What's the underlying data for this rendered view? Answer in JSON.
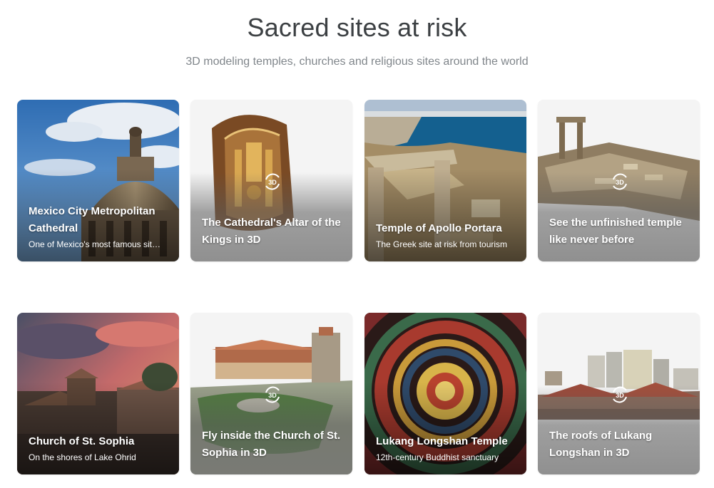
{
  "header": {
    "title": "Sacred sites at risk",
    "subtitle": "3D modeling temples, churches and religious sites around the world"
  },
  "badge_label": "3D",
  "cards": [
    {
      "title": "Mexico City Metropolitan Cathedral",
      "subtitle": "One of Mexico's most famous sit…"
    },
    {
      "title": "The Cathedral's Altar of the Kings in 3D",
      "is_3d": true
    },
    {
      "title": "Temple of Apollo Portara",
      "subtitle": "The Greek site at risk from tourism"
    },
    {
      "title": "See the unfinished temple like never before",
      "is_3d": true
    },
    {
      "title": "Church of St. Sophia",
      "subtitle": "On the shores of Lake Ohrid"
    },
    {
      "title": "Fly inside the Church of St. Sophia in 3D",
      "is_3d": true
    },
    {
      "title": "Lukang Longshan Temple",
      "subtitle": "12th-century Buddhist sanctuary"
    },
    {
      "title": "The roofs of Lukang Longshan in 3D",
      "is_3d": true
    }
  ]
}
